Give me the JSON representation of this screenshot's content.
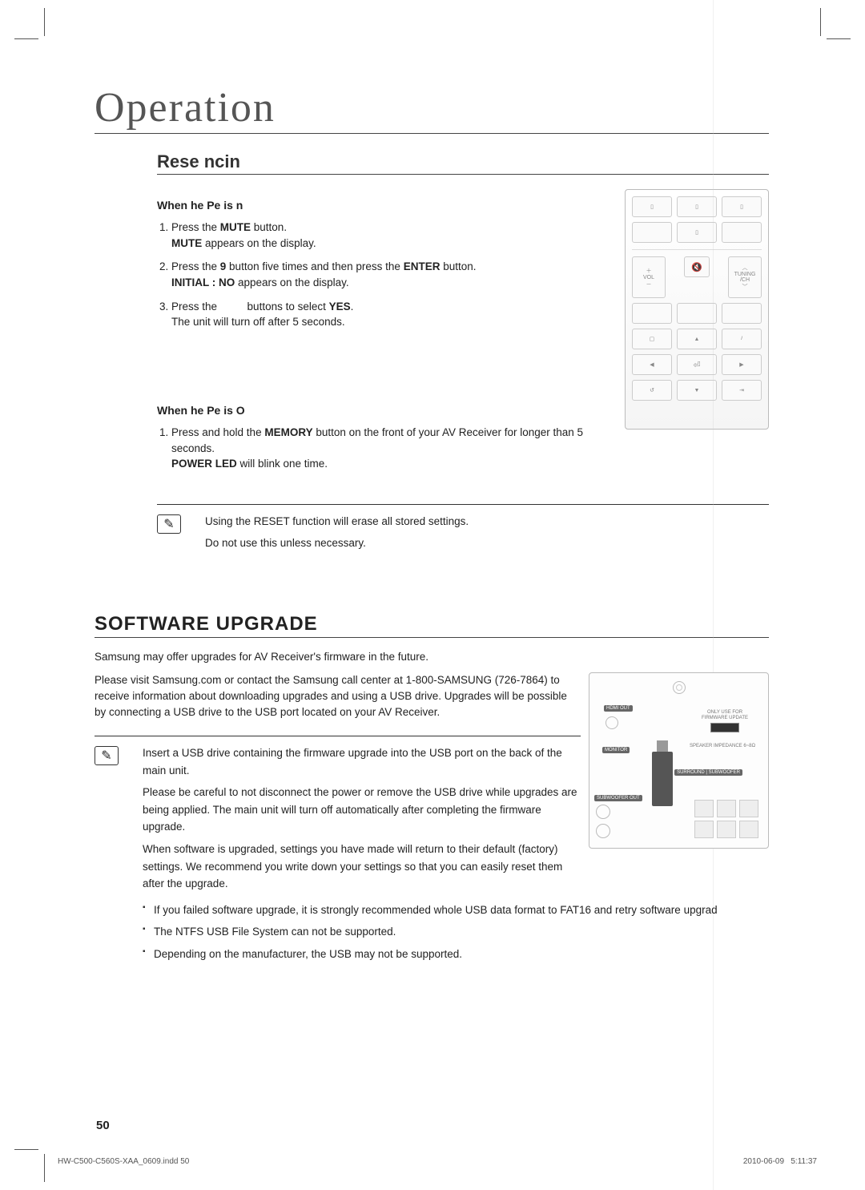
{
  "chapter": "Operation",
  "reset": {
    "heading": "Rese ncin",
    "on": {
      "title": "When he Pe is n",
      "step1_a": "Press the ",
      "step1_b": "MUTE",
      "step1_c": " button.",
      "step1_d": "MUTE",
      "step1_e": " appears on the display.",
      "step2_a": "Press the ",
      "step2_b": "9",
      "step2_c": " button ﬁve times and then press the ",
      "step2_d": "ENTER",
      "step2_e": " button.",
      "step2_f": "INITIAL : NO",
      "step2_g": " appears on the display.",
      "step3_a": "Press the ",
      "step3_b": " buttons to select ",
      "step3_c": "YES",
      "step3_d": ".",
      "step3_e": "The unit will turn off after 5 seconds."
    },
    "off": {
      "title": "When he Pe is O",
      "step1_a": "Press and hold the ",
      "step1_b": "MEMORY",
      "step1_c": " button on the front of your AV Receiver for longer than 5 seconds.",
      "step1_d": "POWER LED",
      "step1_e": " will blink one time."
    },
    "note1": "Using the RESET function will erase all stored settings.",
    "note2": "Do not use this unless necessary."
  },
  "remote": {
    "mute_icon": "🔇",
    "vol": "VOL",
    "tuning": "TUNING /CH",
    "enter": "⏎"
  },
  "software": {
    "heading": "SOFTWARE UPGRADE",
    "p1": "Samsung may offer upgrades for AV Receiver's ﬁrmware in the future.",
    "p2": "Please visit Samsung.com or contact the Samsung call center at 1-800-SAMSUNG (726-7864) to receive information about downloading upgrades and using a USB drive. Upgrades will be possible by connecting a USB drive to the USB port located on your AV Receiver.",
    "note1": "Insert a USB drive containing the ﬁrmware upgrade into the USB port on the back of the main unit.",
    "note2": "Please be careful to not disconnect the power or remove the USB drive while upgrades are being applied. The main unit will turn off automatically after completing the ﬁrmware upgrade.",
    "note3": "When software is upgraded, settings you have made will return to their default (factory) settings. We recommend you write down your settings so that you can easily reset them after the upgrade.",
    "b1": "If you failed software upgrade, it is strongly recommended whole USB data format to FAT16 and retry software upgrad",
    "b2": "The NTFS USB File System can not be supported.",
    "b3": "Depending on the manufacturer, the USB may not be supported."
  },
  "backpanel": {
    "usb_label": "ONLY USE FOR FIRMWARE UPDATE",
    "hdmi": "HDMI OUT",
    "monitor": "MONITOR",
    "sub": "SUBWOOFER OUT",
    "speaker": "SPEAKER IMPEDANCE 6~8Ω",
    "surround": "SURROUND | SUBWOOFER"
  },
  "page_number": "50",
  "footer": {
    "file": "HW-C500-C560S-XAA_0609.indd   50",
    "date": "2010-06-09",
    "time": "5:11:37"
  }
}
